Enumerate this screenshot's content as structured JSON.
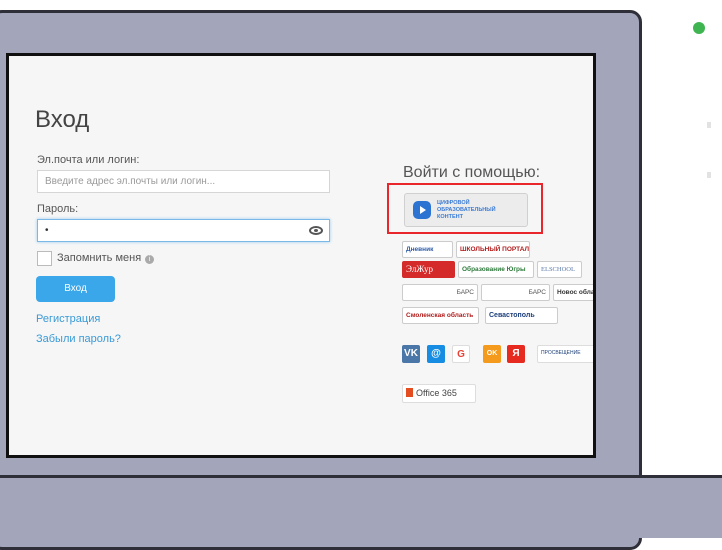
{
  "login": {
    "title": "Вход",
    "email_label": "Эл.почта или логин:",
    "email_placeholder": "Введите адрес эл.почты или логин...",
    "password_label": "Пароль:",
    "password_value": "•",
    "remember_label": "Запомнить меня",
    "submit_label": "Вход",
    "register_link": "Регистрация",
    "forgot_link": "Забыли пароль?"
  },
  "providers": {
    "heading": "Войти с помощью:",
    "highlighted": {
      "line1": "ЦИФРОВОЙ",
      "line2": "ОБРАЗОВАТЕЛЬНЫЙ",
      "line3": "КОНТЕНТ"
    },
    "logos": {
      "dnevnik": "Дневник",
      "school_portal": "ШКОЛЬНЫЙ ПОРТАЛ",
      "eljur": "ЭлЖур",
      "ugra": "Образование Югры",
      "elschool": "ELSCHOOL",
      "bars1": "БАРС",
      "bars2": "БАРС",
      "novosib": "Новос облас",
      "smolensk": "Смоленская область",
      "sevastopol": "Севастополь",
      "vk": "VK",
      "mail": "@",
      "google": "G",
      "ok": "OK",
      "yandex": "Я",
      "prosv": "ПРОСВЕЩЕНИЕ",
      "office": "Office 365"
    }
  },
  "colors": {
    "accent": "#3aa7ea",
    "highlight_border": "#e8262b",
    "status_dot": "#3fb552"
  }
}
